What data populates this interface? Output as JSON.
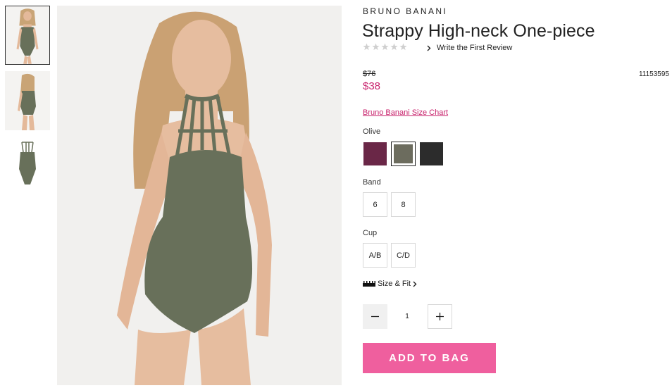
{
  "product": {
    "brand": "BRUNO BANANI",
    "title": "Strappy High-neck One-piece",
    "review_link": "Write the First Review",
    "rating_stars": 0,
    "price_original": "$76",
    "price_sale": "$38",
    "sku": "11153595",
    "size_chart_link": "Bruno Banani Size Chart"
  },
  "color": {
    "selected_label": "Olive",
    "swatches": [
      {
        "name": "plum",
        "hex": "#6a2747"
      },
      {
        "name": "olive",
        "hex": "#6c6c5e"
      },
      {
        "name": "black",
        "hex": "#2c2c2c"
      }
    ]
  },
  "band": {
    "label": "Band",
    "options": [
      "6",
      "8"
    ]
  },
  "cup": {
    "label": "Cup",
    "options": [
      "A/B",
      "C/D"
    ]
  },
  "size_fit": {
    "label": "Size & Fit",
    "icon": "ruler-icon"
  },
  "quantity": {
    "value": "1"
  },
  "cta": {
    "add_to_bag": "ADD TO BAG",
    "color": "#ef5f9e"
  },
  "theme": {
    "accent": "#c8226c",
    "suit_color": "#68705a"
  }
}
